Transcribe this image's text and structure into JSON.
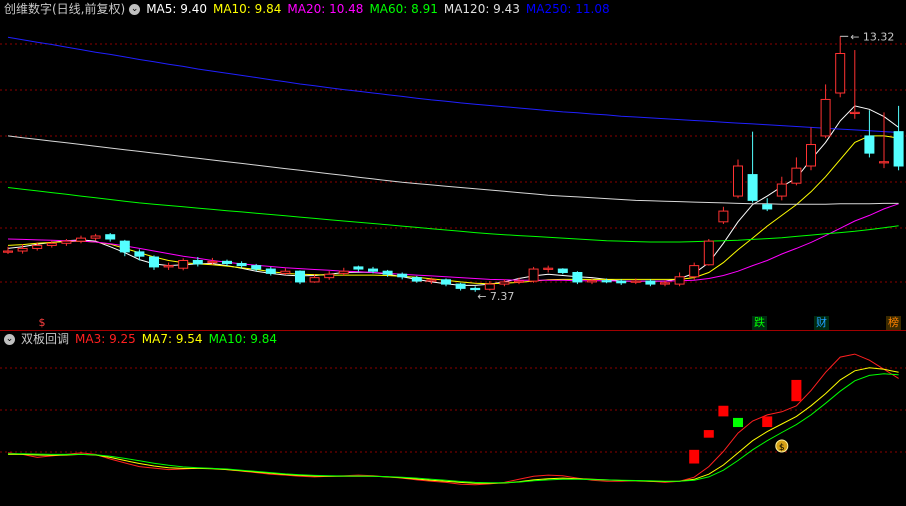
{
  "panel_top": {
    "title": "创维数字(日线,前复权)",
    "indicators": [
      {
        "label": "MA5: 9.40",
        "color": "#ffffff"
      },
      {
        "label": "MA10: 9.84",
        "color": "#ffff00"
      },
      {
        "label": "MA20: 10.48",
        "color": "#ff00ff"
      },
      {
        "label": "MA60: 8.91",
        "color": "#00ff00"
      },
      {
        "label": "MA120: 9.43",
        "color": "#e0e0e0"
      },
      {
        "label": "MA250: 11.08",
        "color": "#0000ff"
      }
    ],
    "high_label": "13.32",
    "low_label": "7.37",
    "tags": [
      {
        "text": "跌",
        "color": "#00ff00"
      },
      {
        "text": "财",
        "color": "#20a0ff"
      },
      {
        "text": "榜",
        "color": "#ff8000"
      }
    ],
    "s_marker": "$"
  },
  "panel_bottom": {
    "title": "双板回调",
    "indicators": [
      {
        "label": "MA3: 9.25",
        "color": "#ff2020"
      },
      {
        "label": "MA7: 9.54",
        "color": "#ffff00"
      },
      {
        "label": "MA10: 9.84",
        "color": "#00ff00"
      }
    ],
    "coin_marker": "$"
  },
  "colors": {
    "up": "#ff3232",
    "down": "#54ffff",
    "grid": "#8b0000"
  },
  "chart_data": {
    "type": "candlestick",
    "ylim": [
      6.9,
      13.7
    ],
    "candles": [
      [
        8.3,
        8.32,
        8.42,
        8.25
      ],
      [
        8.32,
        8.38,
        8.48,
        8.26
      ],
      [
        8.38,
        8.45,
        8.52,
        8.33
      ],
      [
        8.45,
        8.5,
        8.56,
        8.4
      ],
      [
        8.5,
        8.55,
        8.6,
        8.44
      ],
      [
        8.55,
        8.62,
        8.68,
        8.5
      ],
      [
        8.62,
        8.67,
        8.72,
        8.56
      ],
      [
        8.7,
        8.6,
        8.74,
        8.54
      ],
      [
        8.55,
        8.3,
        8.58,
        8.2
      ],
      [
        8.3,
        8.2,
        8.36,
        8.1
      ],
      [
        8.18,
        7.95,
        8.22,
        7.88
      ],
      [
        7.95,
        7.98,
        8.05,
        7.88
      ],
      [
        7.92,
        8.1,
        8.15,
        7.87
      ],
      [
        8.1,
        8.02,
        8.18,
        7.96
      ],
      [
        8.05,
        8.08,
        8.16,
        8.0
      ],
      [
        8.08,
        8.03,
        8.12,
        7.97
      ],
      [
        8.03,
        7.98,
        8.08,
        7.92
      ],
      [
        7.98,
        7.9,
        8.02,
        7.85
      ],
      [
        7.9,
        7.8,
        7.95,
        7.75
      ],
      [
        7.8,
        7.85,
        7.92,
        7.76
      ],
      [
        7.85,
        7.6,
        7.87,
        7.55
      ],
      [
        7.6,
        7.7,
        7.78,
        7.58
      ],
      [
        7.7,
        7.78,
        7.85,
        7.65
      ],
      [
        7.8,
        7.85,
        7.93,
        7.74
      ],
      [
        7.95,
        7.9,
        7.98,
        7.84
      ],
      [
        7.9,
        7.85,
        7.95,
        7.8
      ],
      [
        7.85,
        7.78,
        7.88,
        7.72
      ],
      [
        7.78,
        7.72,
        7.82,
        7.66
      ],
      [
        7.7,
        7.62,
        7.74,
        7.58
      ],
      [
        7.62,
        7.65,
        7.7,
        7.55
      ],
      [
        7.65,
        7.55,
        7.68,
        7.5
      ],
      [
        7.55,
        7.45,
        7.58,
        7.4
      ],
      [
        7.45,
        7.43,
        7.5,
        7.37
      ],
      [
        7.43,
        7.55,
        7.62,
        7.4
      ],
      [
        7.55,
        7.6,
        7.66,
        7.5
      ],
      [
        7.6,
        7.62,
        7.7,
        7.55
      ],
      [
        7.62,
        7.9,
        7.95,
        7.58
      ],
      [
        7.9,
        7.92,
        7.98,
        7.82
      ],
      [
        7.9,
        7.82,
        7.92,
        7.78
      ],
      [
        7.82,
        7.6,
        7.85,
        7.55
      ],
      [
        7.6,
        7.63,
        7.68,
        7.55
      ],
      [
        7.63,
        7.62,
        7.68,
        7.57
      ],
      [
        7.62,
        7.58,
        7.66,
        7.53
      ],
      [
        7.6,
        7.62,
        7.68,
        7.55
      ],
      [
        7.62,
        7.55,
        7.66,
        7.5
      ],
      [
        7.55,
        7.58,
        7.64,
        7.5
      ],
      [
        7.55,
        7.72,
        7.82,
        7.5
      ],
      [
        7.72,
        7.98,
        8.05,
        7.65
      ],
      [
        8.0,
        8.55,
        8.6,
        7.98
      ],
      [
        9.0,
        9.25,
        9.35,
        8.95
      ],
      [
        9.6,
        10.3,
        10.45,
        9.55
      ],
      [
        10.1,
        9.5,
        11.1,
        9.45
      ],
      [
        9.4,
        9.3,
        9.55,
        9.25
      ],
      [
        9.6,
        9.88,
        10.05,
        9.5
      ],
      [
        9.9,
        10.25,
        10.5,
        9.85
      ],
      [
        10.3,
        10.8,
        11.2,
        10.2
      ],
      [
        11.0,
        11.85,
        12.2,
        10.95
      ],
      [
        12.0,
        12.92,
        13.32,
        11.9
      ],
      [
        11.55,
        11.55,
        13.0,
        11.4
      ],
      [
        11.0,
        10.6,
        11.6,
        10.5
      ],
      [
        10.4,
        10.4,
        11.55,
        10.25
      ],
      [
        11.1,
        10.3,
        11.7,
        10.2
      ]
    ],
    "ma_upper": {
      "MA5": [
        8.38,
        8.42,
        8.48,
        8.52,
        8.56,
        8.58,
        8.55,
        8.42,
        8.28,
        8.12,
        8.02,
        7.98,
        8.0,
        8.02,
        8.03,
        7.98,
        7.92,
        7.85,
        7.8,
        7.76,
        7.74,
        7.75,
        7.78,
        7.82,
        7.83,
        7.82,
        7.78,
        7.72,
        7.66,
        7.6,
        7.56,
        7.52,
        7.52,
        7.55,
        7.6,
        7.68,
        7.74,
        7.78,
        7.75,
        7.72,
        7.7,
        7.66,
        7.62,
        7.62,
        7.62,
        7.62,
        7.68,
        7.8,
        8.05,
        8.5,
        9.0,
        9.4,
        9.6,
        9.82,
        10.02,
        10.45,
        10.85,
        11.35,
        11.7,
        11.62,
        11.45,
        11.2
      ],
      "MA10": [
        8.45,
        8.47,
        8.5,
        8.52,
        8.54,
        8.55,
        8.53,
        8.48,
        8.38,
        8.28,
        8.18,
        8.1,
        8.05,
        8.02,
        8.0,
        7.97,
        7.93,
        7.89,
        7.84,
        7.8,
        7.78,
        7.77,
        7.76,
        7.76,
        7.76,
        7.76,
        7.75,
        7.73,
        7.71,
        7.67,
        7.64,
        7.6,
        7.57,
        7.56,
        7.57,
        7.59,
        7.62,
        7.65,
        7.66,
        7.66,
        7.66,
        7.66,
        7.66,
        7.66,
        7.66,
        7.66,
        7.66,
        7.7,
        7.82,
        8.05,
        8.35,
        8.62,
        8.9,
        9.15,
        9.4,
        9.7,
        10.05,
        10.45,
        10.85,
        11.0,
        11.0,
        10.95
      ],
      "MA20": [
        8.6,
        8.59,
        8.58,
        8.57,
        8.56,
        8.55,
        8.53,
        8.49,
        8.44,
        8.38,
        8.32,
        8.26,
        8.2,
        8.15,
        8.1,
        8.06,
        8.02,
        7.99,
        7.96,
        7.93,
        7.91,
        7.89,
        7.87,
        7.85,
        7.84,
        7.82,
        7.8,
        7.78,
        7.76,
        7.74,
        7.72,
        7.7,
        7.68,
        7.66,
        7.65,
        7.64,
        7.64,
        7.64,
        7.64,
        7.63,
        7.63,
        7.63,
        7.62,
        7.62,
        7.62,
        7.62,
        7.63,
        7.64,
        7.68,
        7.75,
        7.85,
        7.98,
        8.1,
        8.25,
        8.38,
        8.52,
        8.68,
        8.85,
        9.02,
        9.15,
        9.3,
        9.42
      ],
      "MA60": [
        9.8,
        9.76,
        9.72,
        9.68,
        9.64,
        9.6,
        9.56,
        9.52,
        9.48,
        9.44,
        9.41,
        9.38,
        9.35,
        9.32,
        9.29,
        9.26,
        9.23,
        9.2,
        9.17,
        9.14,
        9.11,
        9.08,
        9.05,
        9.02,
        8.99,
        8.96,
        8.93,
        8.9,
        8.87,
        8.84,
        8.81,
        8.78,
        8.75,
        8.72,
        8.7,
        8.68,
        8.66,
        8.64,
        8.62,
        8.6,
        8.58,
        8.56,
        8.55,
        8.54,
        8.53,
        8.53,
        8.53,
        8.54,
        8.55,
        8.56,
        8.57,
        8.59,
        8.61,
        8.63,
        8.66,
        8.69,
        8.72,
        8.75,
        8.78,
        8.82,
        8.86,
        8.91
      ],
      "MA120": [
        11.0,
        10.96,
        10.92,
        10.88,
        10.84,
        10.8,
        10.76,
        10.72,
        10.68,
        10.64,
        10.6,
        10.56,
        10.52,
        10.48,
        10.44,
        10.4,
        10.36,
        10.32,
        10.28,
        10.24,
        10.2,
        10.16,
        10.12,
        10.08,
        10.04,
        10.0,
        9.96,
        9.92,
        9.89,
        9.86,
        9.83,
        9.8,
        9.77,
        9.74,
        9.71,
        9.68,
        9.65,
        9.62,
        9.6,
        9.58,
        9.56,
        9.54,
        9.52,
        9.5,
        9.49,
        9.48,
        9.47,
        9.46,
        9.45,
        9.44,
        9.43,
        9.42,
        9.42,
        9.41,
        9.41,
        9.41,
        9.41,
        9.42,
        9.42,
        9.42,
        9.43,
        9.43
      ],
      "MA250": [
        13.3,
        13.24,
        13.18,
        13.13,
        13.07,
        13.01,
        12.95,
        12.9,
        12.84,
        12.78,
        12.73,
        12.67,
        12.62,
        12.56,
        12.51,
        12.46,
        12.41,
        12.36,
        12.31,
        12.26,
        12.21,
        12.17,
        12.12,
        12.08,
        12.04,
        12.0,
        11.96,
        11.92,
        11.88,
        11.84,
        11.81,
        11.77,
        11.74,
        11.71,
        11.68,
        11.65,
        11.62,
        11.59,
        11.56,
        11.54,
        11.51,
        11.49,
        11.46,
        11.44,
        11.42,
        11.4,
        11.38,
        11.36,
        11.34,
        11.32,
        11.3,
        11.28,
        11.26,
        11.24,
        11.22,
        11.2,
        11.18,
        11.16,
        11.14,
        11.12,
        11.1,
        11.08
      ]
    },
    "lower": {
      "ylim": [
        7.0,
        12.0
      ],
      "MA3": [
        8.55,
        8.5,
        8.4,
        8.45,
        8.5,
        8.55,
        8.5,
        8.35,
        8.22,
        8.1,
        8.05,
        8.0,
        8.02,
        8.05,
        8.04,
        8.0,
        7.95,
        7.9,
        7.85,
        7.82,
        7.78,
        7.76,
        7.78,
        7.8,
        7.82,
        7.8,
        7.76,
        7.72,
        7.66,
        7.62,
        7.58,
        7.52,
        7.5,
        7.53,
        7.58,
        7.68,
        7.78,
        7.82,
        7.8,
        7.72,
        7.65,
        7.62,
        7.62,
        7.64,
        7.62,
        7.58,
        7.62,
        7.75,
        8.1,
        8.6,
        9.2,
        9.6,
        9.8,
        9.9,
        10.1,
        10.6,
        11.2,
        11.7,
        11.8,
        11.6,
        11.3,
        11.0
      ],
      "MA7": [
        8.5,
        8.5,
        8.48,
        8.47,
        8.48,
        8.5,
        8.48,
        8.4,
        8.3,
        8.2,
        8.12,
        8.06,
        8.04,
        8.04,
        8.03,
        8.0,
        7.96,
        7.92,
        7.88,
        7.84,
        7.81,
        7.79,
        7.78,
        7.78,
        7.78,
        7.78,
        7.76,
        7.73,
        7.69,
        7.65,
        7.62,
        7.58,
        7.55,
        7.55,
        7.56,
        7.6,
        7.66,
        7.7,
        7.72,
        7.7,
        7.68,
        7.66,
        7.64,
        7.63,
        7.62,
        7.61,
        7.62,
        7.68,
        7.85,
        8.15,
        8.55,
        8.95,
        9.25,
        9.5,
        9.75,
        10.1,
        10.5,
        10.95,
        11.25,
        11.35,
        11.3,
        11.2
      ],
      "MA10": [
        8.52,
        8.52,
        8.51,
        8.5,
        8.5,
        8.5,
        8.49,
        8.44,
        8.37,
        8.29,
        8.21,
        8.14,
        8.09,
        8.06,
        8.04,
        8.02,
        7.98,
        7.94,
        7.9,
        7.86,
        7.83,
        7.81,
        7.8,
        7.79,
        7.79,
        7.78,
        7.77,
        7.75,
        7.72,
        7.68,
        7.65,
        7.61,
        7.58,
        7.57,
        7.57,
        7.59,
        7.63,
        7.66,
        7.68,
        7.68,
        7.67,
        7.66,
        7.65,
        7.64,
        7.63,
        7.62,
        7.62,
        7.65,
        7.76,
        7.98,
        8.3,
        8.65,
        8.95,
        9.22,
        9.48,
        9.8,
        10.18,
        10.58,
        10.92,
        11.1,
        11.15,
        11.12
      ]
    },
    "signals": [
      {
        "i": 47,
        "v0": 8.2,
        "v1": 8.65,
        "color": "red"
      },
      {
        "i": 48,
        "v0": 9.05,
        "v1": 9.3,
        "color": "red"
      },
      {
        "i": 49,
        "v0": 9.75,
        "v1": 10.1,
        "color": "red"
      },
      {
        "i": 50,
        "v0": 9.4,
        "v1": 9.7,
        "color": "lime"
      },
      {
        "i": 52,
        "v0": 9.4,
        "v1": 9.75,
        "color": "red"
      },
      {
        "i": 54,
        "v0": 10.25,
        "v1": 10.95,
        "color": "red"
      }
    ]
  }
}
